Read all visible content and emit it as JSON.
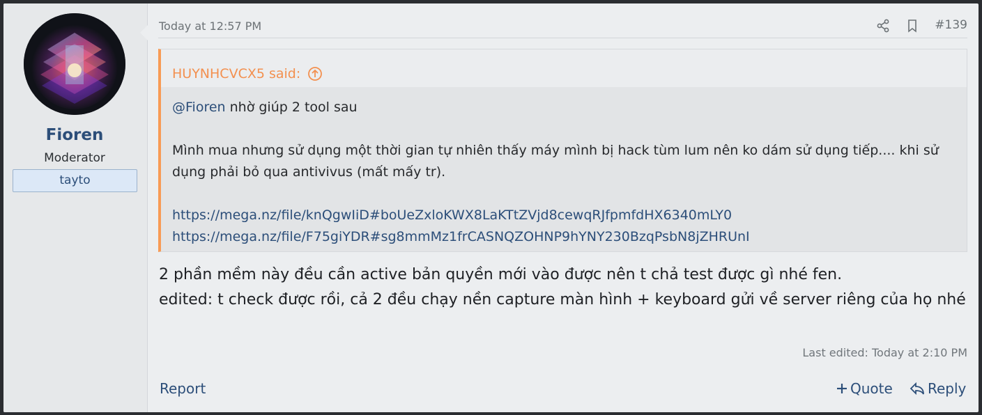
{
  "user": {
    "name": "Fioren",
    "title": "Moderator",
    "banner": "tayto"
  },
  "post": {
    "date": "Today at 12:57 PM",
    "number": "#139",
    "header_icons": [
      "share-icon",
      "bookmark-icon"
    ],
    "quote": {
      "author_said": "HUYNHCVCX5 said:",
      "mention": "@Fioren",
      "line1_rest": " nhờ giúp 2 tool sau",
      "paragraph2": "Mình mua nhưng sử dụng một thời gian tự nhiên thấy máy mình bị hack tùm lum nên ko dám sử dụng tiếp.... khi sử dụng phải bỏ qua antivivus (mất mấy tr).",
      "links": [
        "https://mega.nz/file/knQgwIiD#boUeZxloKWX8LaKTtZVjd8cewqRJfpmfdHX6340mLY0",
        "https://mega.nz/file/F75giYDR#sg8mmMz1frCASNQZOHNP9hYNY230BzqPsbN8jZHRUnI"
      ]
    },
    "body_line1": "2 phần mềm này đều cần active bản quyền mới vào được nên t chả test được gì nhé fen.",
    "body_line2": "edited: t check được rồi, cả 2 đều chạy nền capture màn hình + keyboard gửi về server riêng của họ nhé",
    "last_edited": "Last edited: Today at 2:10 PM"
  },
  "actions": {
    "report": "Report",
    "quote": "Quote",
    "reply": "Reply"
  },
  "colors": {
    "accent": "#2c4e79",
    "quote_bar": "#f89b55",
    "quote_title": "#f3904f"
  }
}
